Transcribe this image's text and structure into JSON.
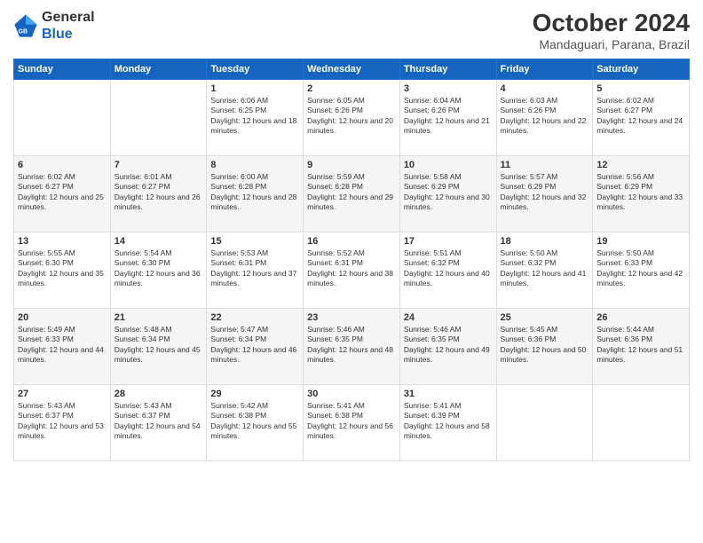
{
  "logo": {
    "general": "General",
    "blue": "Blue"
  },
  "title": "October 2024",
  "subtitle": "Mandaguari, Parana, Brazil",
  "headers": [
    "Sunday",
    "Monday",
    "Tuesday",
    "Wednesday",
    "Thursday",
    "Friday",
    "Saturday"
  ],
  "weeks": [
    [
      {
        "day": "",
        "sunrise": "",
        "sunset": "",
        "daylight": ""
      },
      {
        "day": "",
        "sunrise": "",
        "sunset": "",
        "daylight": ""
      },
      {
        "day": "1",
        "sunrise": "Sunrise: 6:06 AM",
        "sunset": "Sunset: 6:25 PM",
        "daylight": "Daylight: 12 hours and 18 minutes."
      },
      {
        "day": "2",
        "sunrise": "Sunrise: 6:05 AM",
        "sunset": "Sunset: 6:26 PM",
        "daylight": "Daylight: 12 hours and 20 minutes."
      },
      {
        "day": "3",
        "sunrise": "Sunrise: 6:04 AM",
        "sunset": "Sunset: 6:26 PM",
        "daylight": "Daylight: 12 hours and 21 minutes."
      },
      {
        "day": "4",
        "sunrise": "Sunrise: 6:03 AM",
        "sunset": "Sunset: 6:26 PM",
        "daylight": "Daylight: 12 hours and 22 minutes."
      },
      {
        "day": "5",
        "sunrise": "Sunrise: 6:02 AM",
        "sunset": "Sunset: 6:27 PM",
        "daylight": "Daylight: 12 hours and 24 minutes."
      }
    ],
    [
      {
        "day": "6",
        "sunrise": "Sunrise: 6:02 AM",
        "sunset": "Sunset: 6:27 PM",
        "daylight": "Daylight: 12 hours and 25 minutes."
      },
      {
        "day": "7",
        "sunrise": "Sunrise: 6:01 AM",
        "sunset": "Sunset: 6:27 PM",
        "daylight": "Daylight: 12 hours and 26 minutes."
      },
      {
        "day": "8",
        "sunrise": "Sunrise: 6:00 AM",
        "sunset": "Sunset: 6:28 PM",
        "daylight": "Daylight: 12 hours and 28 minutes."
      },
      {
        "day": "9",
        "sunrise": "Sunrise: 5:59 AM",
        "sunset": "Sunset: 6:28 PM",
        "daylight": "Daylight: 12 hours and 29 minutes."
      },
      {
        "day": "10",
        "sunrise": "Sunrise: 5:58 AM",
        "sunset": "Sunset: 6:29 PM",
        "daylight": "Daylight: 12 hours and 30 minutes."
      },
      {
        "day": "11",
        "sunrise": "Sunrise: 5:57 AM",
        "sunset": "Sunset: 6:29 PM",
        "daylight": "Daylight: 12 hours and 32 minutes."
      },
      {
        "day": "12",
        "sunrise": "Sunrise: 5:56 AM",
        "sunset": "Sunset: 6:29 PM",
        "daylight": "Daylight: 12 hours and 33 minutes."
      }
    ],
    [
      {
        "day": "13",
        "sunrise": "Sunrise: 5:55 AM",
        "sunset": "Sunset: 6:30 PM",
        "daylight": "Daylight: 12 hours and 35 minutes."
      },
      {
        "day": "14",
        "sunrise": "Sunrise: 5:54 AM",
        "sunset": "Sunset: 6:30 PM",
        "daylight": "Daylight: 12 hours and 36 minutes."
      },
      {
        "day": "15",
        "sunrise": "Sunrise: 5:53 AM",
        "sunset": "Sunset: 6:31 PM",
        "daylight": "Daylight: 12 hours and 37 minutes."
      },
      {
        "day": "16",
        "sunrise": "Sunrise: 5:52 AM",
        "sunset": "Sunset: 6:31 PM",
        "daylight": "Daylight: 12 hours and 38 minutes."
      },
      {
        "day": "17",
        "sunrise": "Sunrise: 5:51 AM",
        "sunset": "Sunset: 6:32 PM",
        "daylight": "Daylight: 12 hours and 40 minutes."
      },
      {
        "day": "18",
        "sunrise": "Sunrise: 5:50 AM",
        "sunset": "Sunset: 6:32 PM",
        "daylight": "Daylight: 12 hours and 41 minutes."
      },
      {
        "day": "19",
        "sunrise": "Sunrise: 5:50 AM",
        "sunset": "Sunset: 6:33 PM",
        "daylight": "Daylight: 12 hours and 42 minutes."
      }
    ],
    [
      {
        "day": "20",
        "sunrise": "Sunrise: 5:49 AM",
        "sunset": "Sunset: 6:33 PM",
        "daylight": "Daylight: 12 hours and 44 minutes."
      },
      {
        "day": "21",
        "sunrise": "Sunrise: 5:48 AM",
        "sunset": "Sunset: 6:34 PM",
        "daylight": "Daylight: 12 hours and 45 minutes."
      },
      {
        "day": "22",
        "sunrise": "Sunrise: 5:47 AM",
        "sunset": "Sunset: 6:34 PM",
        "daylight": "Daylight: 12 hours and 46 minutes."
      },
      {
        "day": "23",
        "sunrise": "Sunrise: 5:46 AM",
        "sunset": "Sunset: 6:35 PM",
        "daylight": "Daylight: 12 hours and 48 minutes."
      },
      {
        "day": "24",
        "sunrise": "Sunrise: 5:46 AM",
        "sunset": "Sunset: 6:35 PM",
        "daylight": "Daylight: 12 hours and 49 minutes."
      },
      {
        "day": "25",
        "sunrise": "Sunrise: 5:45 AM",
        "sunset": "Sunset: 6:36 PM",
        "daylight": "Daylight: 12 hours and 50 minutes."
      },
      {
        "day": "26",
        "sunrise": "Sunrise: 5:44 AM",
        "sunset": "Sunset: 6:36 PM",
        "daylight": "Daylight: 12 hours and 51 minutes."
      }
    ],
    [
      {
        "day": "27",
        "sunrise": "Sunrise: 5:43 AM",
        "sunset": "Sunset: 6:37 PM",
        "daylight": "Daylight: 12 hours and 53 minutes."
      },
      {
        "day": "28",
        "sunrise": "Sunrise: 5:43 AM",
        "sunset": "Sunset: 6:37 PM",
        "daylight": "Daylight: 12 hours and 54 minutes."
      },
      {
        "day": "29",
        "sunrise": "Sunrise: 5:42 AM",
        "sunset": "Sunset: 6:38 PM",
        "daylight": "Daylight: 12 hours and 55 minutes."
      },
      {
        "day": "30",
        "sunrise": "Sunrise: 5:41 AM",
        "sunset": "Sunset: 6:38 PM",
        "daylight": "Daylight: 12 hours and 56 minutes."
      },
      {
        "day": "31",
        "sunrise": "Sunrise: 5:41 AM",
        "sunset": "Sunset: 6:39 PM",
        "daylight": "Daylight: 12 hours and 58 minutes."
      },
      {
        "day": "",
        "sunrise": "",
        "sunset": "",
        "daylight": ""
      },
      {
        "day": "",
        "sunrise": "",
        "sunset": "",
        "daylight": ""
      }
    ]
  ]
}
